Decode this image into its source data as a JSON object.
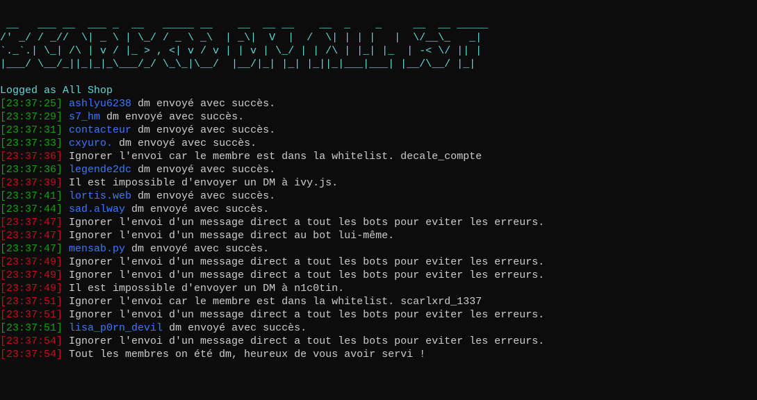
{
  "banner": [
    " __   ___ __  ___ _  __   _____ __    __  __ __    __  _    _     __  __ _____",
    "/' _/ / _//  \\| _ \\ | \\_/ / _ \\ _\\  | _\\|  V  |  /  \\| | | |   |  \\/__\\_   _|",
    "`._`.| \\_| /\\ | v / |_ > , <| v / v | | v | \\_/ | | /\\ | |_| |_  | -< \\/ || |",
    "|___/ \\__/_||_|_|_\\___/_/ \\_\\_|\\__/  |__/|_| |_| |_||_|___|___| |__/\\__/ |_|"
  ],
  "logged_as": "Logged as All Shop",
  "colors": {
    "cyan": "#61d6d6",
    "green": "#13a10e",
    "red": "#c50f1f",
    "blue": "#3b78ff",
    "text": "#cccccc",
    "background": "#0c0c0c"
  },
  "log": [
    {
      "time": "[23:37:25]",
      "status": "success",
      "user": "ashlyu6238",
      "msg": " dm envoyé avec succès."
    },
    {
      "time": "[23:37:29]",
      "status": "success",
      "user": "s7_hm",
      "msg": " dm envoyé avec succès."
    },
    {
      "time": "[23:37:31]",
      "status": "success",
      "user": "contacteur",
      "msg": " dm envoyé avec succès."
    },
    {
      "time": "[23:37:33]",
      "status": "success",
      "user": "cxyuro.",
      "msg": " dm envoyé avec succès."
    },
    {
      "time": "[23:37:36]",
      "status": "error",
      "user": "",
      "msg": " Ignorer l'envoi car le membre est dans la whitelist. decale_compte"
    },
    {
      "time": "[23:37:36]",
      "status": "success",
      "user": "legende2dc",
      "msg": " dm envoyé avec succès."
    },
    {
      "time": "[23:37:39]",
      "status": "error",
      "user": "",
      "msg": " Il est impossible d'envoyer un DM à ivy.js."
    },
    {
      "time": "[23:37:41]",
      "status": "success",
      "user": "lortis.web",
      "msg": " dm envoyé avec succès."
    },
    {
      "time": "[23:37:44]",
      "status": "success",
      "user": "sad.alway",
      "msg": " dm envoyé avec succès."
    },
    {
      "time": "[23:37:47]",
      "status": "error",
      "user": "",
      "msg": " Ignorer l'envoi d'un message direct a tout les bots pour eviter les erreurs."
    },
    {
      "time": "[23:37:47]",
      "status": "error",
      "user": "",
      "msg": " Ignorer l'envoi d'un message direct au bot lui-même."
    },
    {
      "time": "[23:37:47]",
      "status": "success",
      "user": "mensab.py",
      "msg": " dm envoyé avec succès."
    },
    {
      "time": "[23:37:49]",
      "status": "error",
      "user": "",
      "msg": " Ignorer l'envoi d'un message direct a tout les bots pour eviter les erreurs."
    },
    {
      "time": "[23:37:49]",
      "status": "error",
      "user": "",
      "msg": " Ignorer l'envoi d'un message direct a tout les bots pour eviter les erreurs."
    },
    {
      "time": "[23:37:49]",
      "status": "error",
      "user": "",
      "msg": " Il est impossible d'envoyer un DM à n1c0tin."
    },
    {
      "time": "[23:37:51]",
      "status": "error",
      "user": "",
      "msg": " Ignorer l'envoi car le membre est dans la whitelist. scarlxrd_1337"
    },
    {
      "time": "[23:37:51]",
      "status": "error",
      "user": "",
      "msg": " Ignorer l'envoi d'un message direct a tout les bots pour eviter les erreurs."
    },
    {
      "time": "[23:37:51]",
      "status": "success",
      "user": "lisa_p0rn_devil",
      "msg": " dm envoyé avec succès."
    },
    {
      "time": "[23:37:54]",
      "status": "error",
      "user": "",
      "msg": " Ignorer l'envoi d'un message direct a tout les bots pour eviter les erreurs."
    },
    {
      "time": "[23:37:54]",
      "status": "error",
      "user": "",
      "msg": " Tout les membres on été dm, heureux de vous avoir servi !"
    }
  ]
}
